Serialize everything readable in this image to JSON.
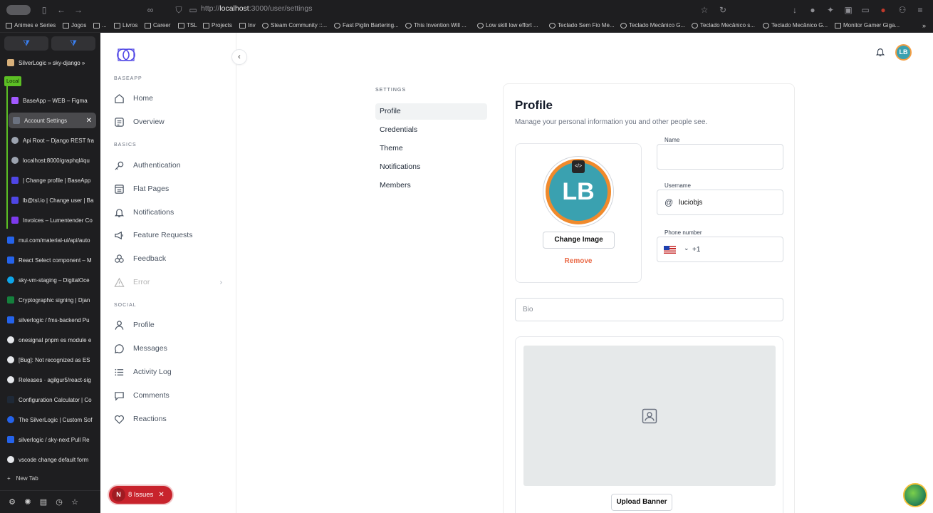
{
  "browser": {
    "url_prefix": "http://",
    "url_host": "localhost",
    "url_rest": ":3000/user/settings"
  },
  "bookmarks": [
    "Animes e Series",
    "Jogos",
    "...",
    "Livros",
    "Career",
    "TSL",
    "Projects",
    "Inv",
    "Steam Community ::...",
    "Fast Piglin Bartering...",
    "This Invention Will ...",
    "Low skill low effort ...",
    "Teclado Sem Fio Me...",
    "Teclado Mecânico G...",
    "Teclado Mecânico s...",
    "Teclado Mecânico G...",
    "Monitor Gamer Giga..."
  ],
  "tabs": {
    "local_label": "Local",
    "new_tab": "New Tab",
    "items": [
      "SilverLogic » sky-django »",
      "BaseApp – WEB – Figma",
      "Account Settings",
      "Api Root – Django REST fra",
      "localhost:8000/graphql#qu",
      "| Change profile | BaseApp",
      "lb@tsl.io | Change user | Ba",
      "Invoices – Lumentender Co",
      "mui.com/material-ui/api/auto",
      "React Select component – M",
      "sky-vm-staging – DigitalOce",
      "Cryptographic signing | Djan",
      "silverlogic / fms-backend Pu",
      "onesignal pnpm es module e",
      "[Bug]: Not recognized as ES",
      "Releases · agilgur5/react-sig",
      "Configuration Calculator | Co",
      "The SilverLogic | Custom Sof",
      "silverlogic / sky-next Pull Re",
      "vscode change default form"
    ]
  },
  "nav": {
    "sections": {
      "baseapp": "BASEAPP",
      "basics": "BASICS",
      "social": "SOCIAL"
    },
    "home": "Home",
    "overview": "Overview",
    "authentication": "Authentication",
    "flat_pages": "Flat Pages",
    "notifications": "Notifications",
    "feature_requests": "Feature Requests",
    "feedback": "Feedback",
    "error": "Error",
    "profile": "Profile",
    "messages": "Messages",
    "activity_log": "Activity Log",
    "comments": "Comments",
    "reactions": "Reactions"
  },
  "user": {
    "initials": "LB"
  },
  "settings": {
    "label": "SETTINGS",
    "items": [
      "Profile",
      "Credentials",
      "Theme",
      "Notifications",
      "Members"
    ]
  },
  "profile": {
    "title": "Profile",
    "subtitle": "Manage your personal information you and other people see.",
    "change_image": "Change Image",
    "remove": "Remove",
    "name_label": "Name",
    "name_value": "",
    "username_label": "Username",
    "username_value": "luciobjs",
    "phone_label": "Phone number",
    "phone_code": "+1",
    "bio_placeholder": "Bio",
    "upload_banner": "Upload Banner"
  },
  "issues": {
    "letter": "N",
    "label": "8 Issues"
  },
  "colors": {
    "accent_orange": "#ea6a47",
    "avatar_teal": "#3aa1b0",
    "issues_red": "#c8232c"
  }
}
